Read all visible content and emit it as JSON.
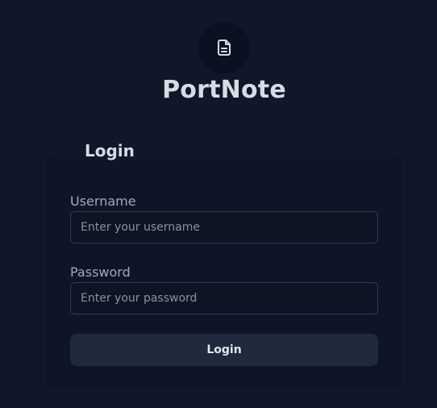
{
  "app": {
    "title": "PortNote",
    "logo_icon": "file-text-icon"
  },
  "login_card": {
    "title": "Login",
    "username": {
      "label": "Username",
      "value": "",
      "placeholder": "Enter your username"
    },
    "password": {
      "label": "Password",
      "value": "",
      "placeholder": "Enter your password"
    },
    "submit_label": "Login"
  },
  "colors": {
    "background": "#101729",
    "card": "#0e1527",
    "button": "#1f2a3d",
    "text": "#d7dbe2",
    "muted_text": "#a2a9b6"
  }
}
